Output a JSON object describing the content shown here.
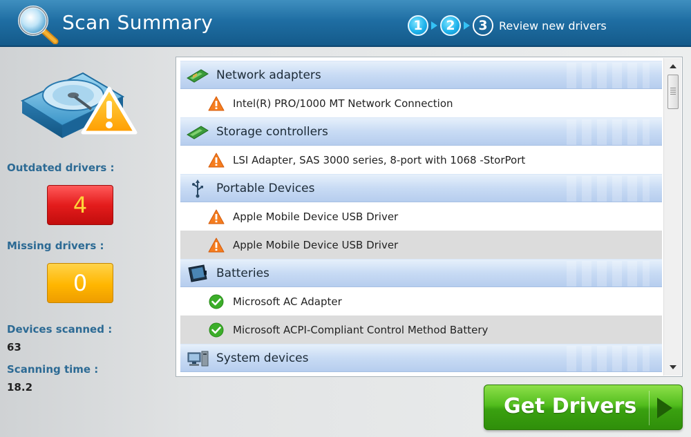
{
  "header": {
    "title": "Scan Summary",
    "logo_icon": "magnifier-icon",
    "steps": [
      {
        "number": "1",
        "state": "done"
      },
      {
        "number": "2",
        "state": "done"
      },
      {
        "number": "3",
        "state": "current"
      }
    ],
    "current_step_label": "Review new drivers"
  },
  "summary": {
    "icon": "hard-drive-warning-icon",
    "outdated_label": "Outdated drivers :",
    "outdated_count": "4",
    "missing_label": "Missing drivers :",
    "missing_count": "0",
    "devices_scanned_label": "Devices scanned :",
    "devices_scanned_value": "63",
    "scanning_time_label": "Scanning time :",
    "scanning_time_value": "18.2"
  },
  "drivers": [
    {
      "category": "Network adapters",
      "icon": "network-card-icon",
      "items": [
        {
          "name": "Intel(R) PRO/1000 MT Network Connection",
          "status": "warning"
        }
      ]
    },
    {
      "category": "Storage controllers",
      "icon": "storage-card-icon",
      "items": [
        {
          "name": "LSI Adapter, SAS 3000 series, 8-port with 1068 -StorPort",
          "status": "warning"
        }
      ]
    },
    {
      "category": "Portable Devices",
      "icon": "usb-icon",
      "items": [
        {
          "name": "Apple Mobile Device USB Driver",
          "status": "warning"
        },
        {
          "name": "Apple Mobile Device USB Driver",
          "status": "warning"
        }
      ]
    },
    {
      "category": "Batteries",
      "icon": "battery-icon",
      "items": [
        {
          "name": "Microsoft AC Adapter",
          "status": "ok"
        },
        {
          "name": "Microsoft ACPI-Compliant Control Method Battery",
          "status": "ok"
        }
      ]
    },
    {
      "category": "System devices",
      "icon": "computer-icon",
      "items": []
    }
  ],
  "colors": {
    "header_blue": "#1f6ea3",
    "outdated_red": "#e41c1c",
    "missing_yellow": "#ffb600",
    "button_green": "#3aa110",
    "warning_orange": "#f57d1f",
    "ok_green": "#3cae2a"
  },
  "action": {
    "get_drivers_label": "Get Drivers"
  }
}
